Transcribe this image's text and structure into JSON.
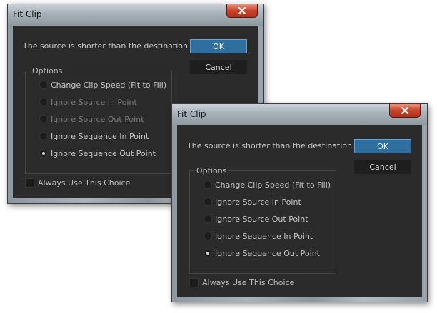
{
  "dialogs": [
    {
      "title": "Fit Clip",
      "message": "The source is shorter than the destination.",
      "ok_label": "OK",
      "cancel_label": "Cancel",
      "options_legend": "Options",
      "options": [
        {
          "label": "Change Clip Speed (Fit to Fill)",
          "enabled": true,
          "selected": false
        },
        {
          "label": "Ignore Source In Point",
          "enabled": false,
          "selected": false
        },
        {
          "label": "Ignore Source Out Point",
          "enabled": false,
          "selected": false
        },
        {
          "label": "Ignore Sequence In Point",
          "enabled": true,
          "selected": false
        },
        {
          "label": "Ignore Sequence Out Point",
          "enabled": true,
          "selected": true
        }
      ],
      "checkbox_label": "Always Use This Choice",
      "checkbox_checked": false
    },
    {
      "title": "Fit Clip",
      "message": "The source is shorter than the destination.",
      "ok_label": "OK",
      "cancel_label": "Cancel",
      "options_legend": "Options",
      "options": [
        {
          "label": "Change Clip Speed (Fit to Fill)",
          "enabled": true,
          "selected": false
        },
        {
          "label": "Ignore Source In Point",
          "enabled": true,
          "selected": false
        },
        {
          "label": "Ignore Source Out Point",
          "enabled": true,
          "selected": false
        },
        {
          "label": "Ignore Sequence In Point",
          "enabled": true,
          "selected": false
        },
        {
          "label": "Ignore Sequence Out Point",
          "enabled": true,
          "selected": true
        }
      ],
      "checkbox_label": "Always Use This Choice",
      "checkbox_checked": false
    }
  ],
  "colors": {
    "client_bg": "#2b2b2b",
    "ok_button": "#2f6f9f",
    "close_button": "#c7432a"
  },
  "icons": {
    "close": "close-icon"
  }
}
